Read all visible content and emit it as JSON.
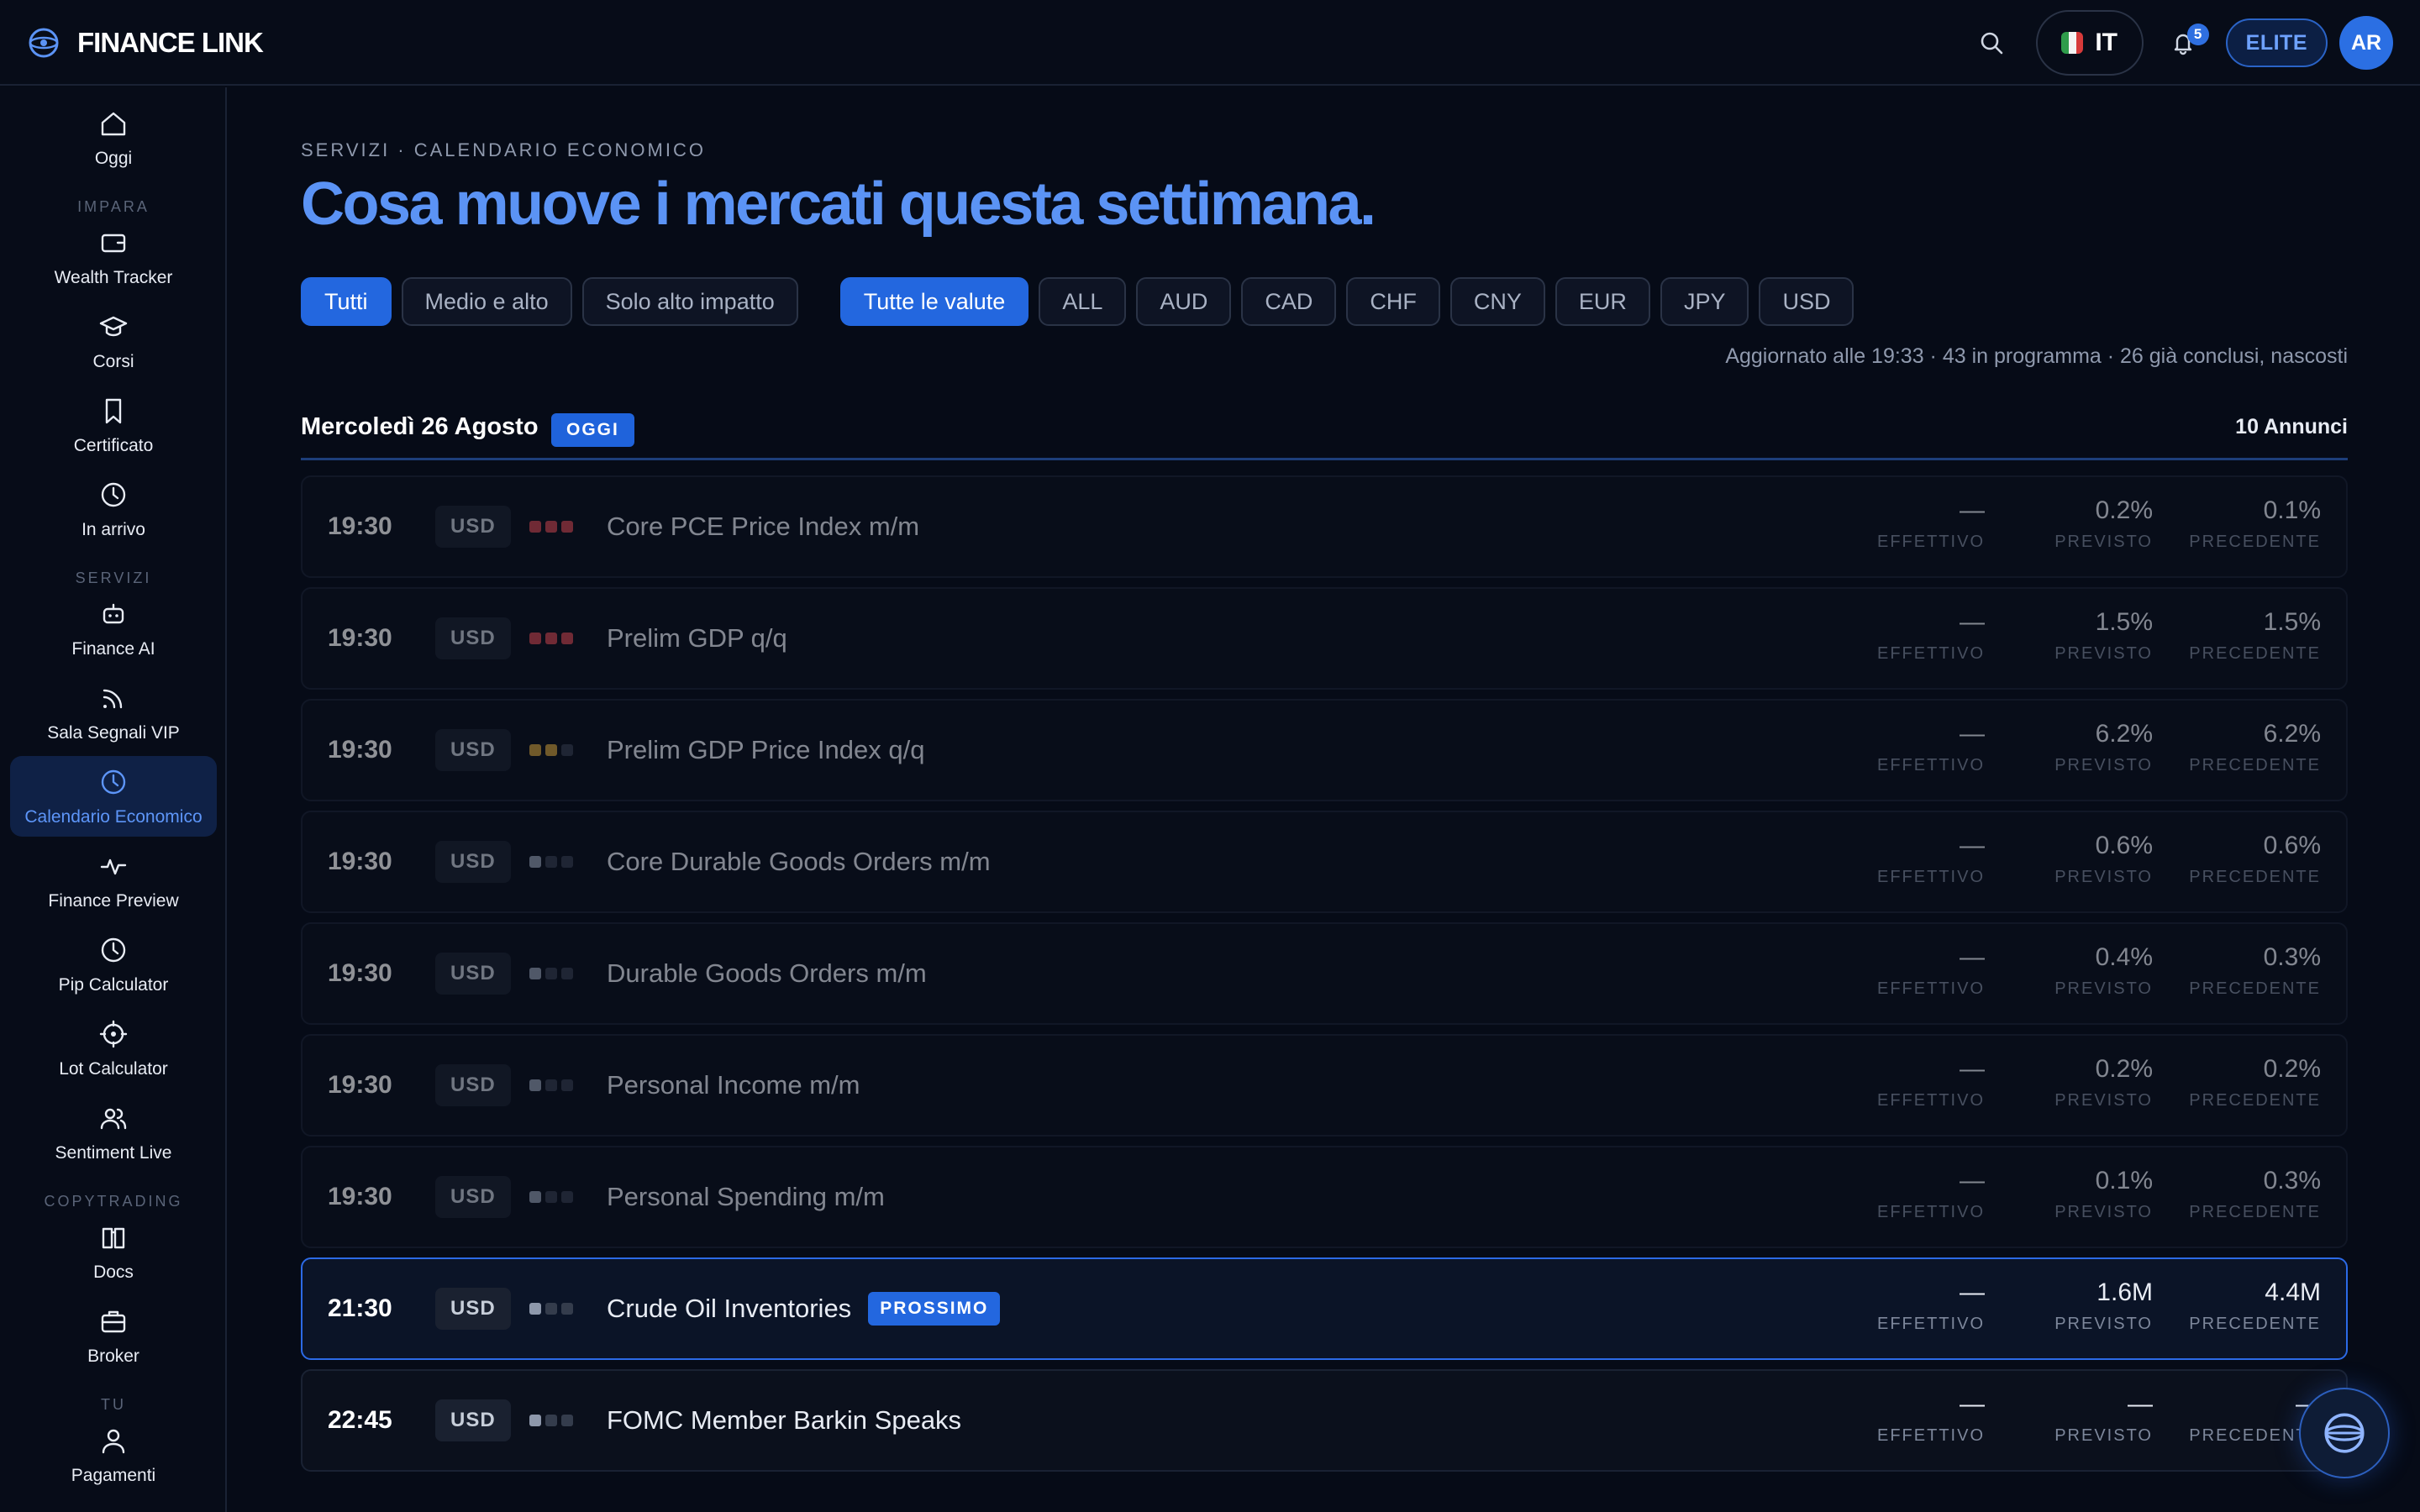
{
  "brand": {
    "name": "FINANCE LINK"
  },
  "header": {
    "language": "IT",
    "notifications_count": "5",
    "plan": "ELITE",
    "avatar_initials": "AR",
    "flag_colors": [
      "#2f9c4b",
      "#f4f4f4",
      "#d63a3a"
    ]
  },
  "sidebar": {
    "items": [
      {
        "label": "Oggi",
        "icon": "home-icon"
      },
      {
        "section": "IMPARA"
      },
      {
        "label": "Wealth Tracker",
        "icon": "wallet-icon"
      },
      {
        "label": "Corsi",
        "icon": "graduation-cap-icon"
      },
      {
        "label": "Certificato",
        "icon": "bookmark-icon"
      },
      {
        "label": "In arrivo",
        "icon": "clock-icon"
      },
      {
        "section": "SERVIZI"
      },
      {
        "label": "Finance AI",
        "icon": "robot-icon"
      },
      {
        "label": "Sala Segnali VIP",
        "icon": "signal-icon"
      },
      {
        "label": "Calendario Economico",
        "icon": "clock-icon",
        "active": true
      },
      {
        "label": "Finance Preview",
        "icon": "activity-icon"
      },
      {
        "label": "Pip Calculator",
        "icon": "clock-icon"
      },
      {
        "label": "Lot Calculator",
        "icon": "crosshair-icon"
      },
      {
        "label": "Sentiment Live",
        "icon": "users-icon"
      },
      {
        "section": "COPYTRADING"
      },
      {
        "label": "Docs",
        "icon": "book-open-icon"
      },
      {
        "label": "Broker",
        "icon": "briefcase-icon"
      },
      {
        "section": "TU"
      },
      {
        "label": "Pagamenti",
        "icon": "user-icon"
      }
    ]
  },
  "page": {
    "breadcrumb": "SERVIZI · CALENDARIO ECONOMICO",
    "title": "Cosa muove i mercati questa settimana."
  },
  "filters": {
    "impact": [
      {
        "label": "Tutti",
        "active": true
      },
      {
        "label": "Medio e alto",
        "active": false
      },
      {
        "label": "Solo alto impatto",
        "active": false
      }
    ],
    "currencies": [
      {
        "label": "Tutte le valute",
        "active": true
      },
      {
        "label": "ALL",
        "active": false
      },
      {
        "label": "AUD",
        "active": false
      },
      {
        "label": "CAD",
        "active": false
      },
      {
        "label": "CHF",
        "active": false
      },
      {
        "label": "CNY",
        "active": false
      },
      {
        "label": "EUR",
        "active": false
      },
      {
        "label": "JPY",
        "active": false
      },
      {
        "label": "USD",
        "active": false
      }
    ]
  },
  "status_line": "Aggiornato alle 19:33 · 43 in programma · 26 già conclusi, nascosti",
  "day": {
    "title": "Mercoledì 26 Agosto",
    "badge": "OGGI",
    "count": "10 Annunci"
  },
  "labels": {
    "actual": "EFFETTIVO",
    "forecast": "PREVISTO",
    "previous": "PRECEDENTE",
    "next_badge": "PROSSIMO"
  },
  "events": [
    {
      "time": "19:30",
      "currency": "USD",
      "impact": "high",
      "name": "Core PCE Price Index m/m",
      "actual": "—",
      "forecast": "0.2%",
      "previous": "0.1%",
      "state": "past"
    },
    {
      "time": "19:30",
      "currency": "USD",
      "impact": "high",
      "name": "Prelim GDP q/q",
      "actual": "—",
      "forecast": "1.5%",
      "previous": "1.5%",
      "state": "past"
    },
    {
      "time": "19:30",
      "currency": "USD",
      "impact": "medium",
      "name": "Prelim GDP Price Index q/q",
      "actual": "—",
      "forecast": "6.2%",
      "previous": "6.2%",
      "state": "past"
    },
    {
      "time": "19:30",
      "currency": "USD",
      "impact": "low",
      "name": "Core Durable Goods Orders m/m",
      "actual": "—",
      "forecast": "0.6%",
      "previous": "0.6%",
      "state": "past"
    },
    {
      "time": "19:30",
      "currency": "USD",
      "impact": "low",
      "name": "Durable Goods Orders m/m",
      "actual": "—",
      "forecast": "0.4%",
      "previous": "0.3%",
      "state": "past"
    },
    {
      "time": "19:30",
      "currency": "USD",
      "impact": "low",
      "name": "Personal Income m/m",
      "actual": "—",
      "forecast": "0.2%",
      "previous": "0.2%",
      "state": "past"
    },
    {
      "time": "19:30",
      "currency": "USD",
      "impact": "low",
      "name": "Personal Spending m/m",
      "actual": "—",
      "forecast": "0.1%",
      "previous": "0.3%",
      "state": "past"
    },
    {
      "time": "21:30",
      "currency": "USD",
      "impact": "low",
      "name": "Crude Oil Inventories",
      "actual": "—",
      "forecast": "1.6M",
      "previous": "4.4M",
      "state": "next"
    },
    {
      "time": "22:45",
      "currency": "USD",
      "impact": "low",
      "name": "FOMC Member Barkin Speaks",
      "actual": "—",
      "forecast": "—",
      "previous": "—",
      "state": "upcoming"
    }
  ],
  "colors": {
    "accent": "#2367df",
    "title": "#5b93f5",
    "high_impact": "#c8454f",
    "medium_impact": "#c79a3a",
    "low_impact": "#8e98ab"
  }
}
